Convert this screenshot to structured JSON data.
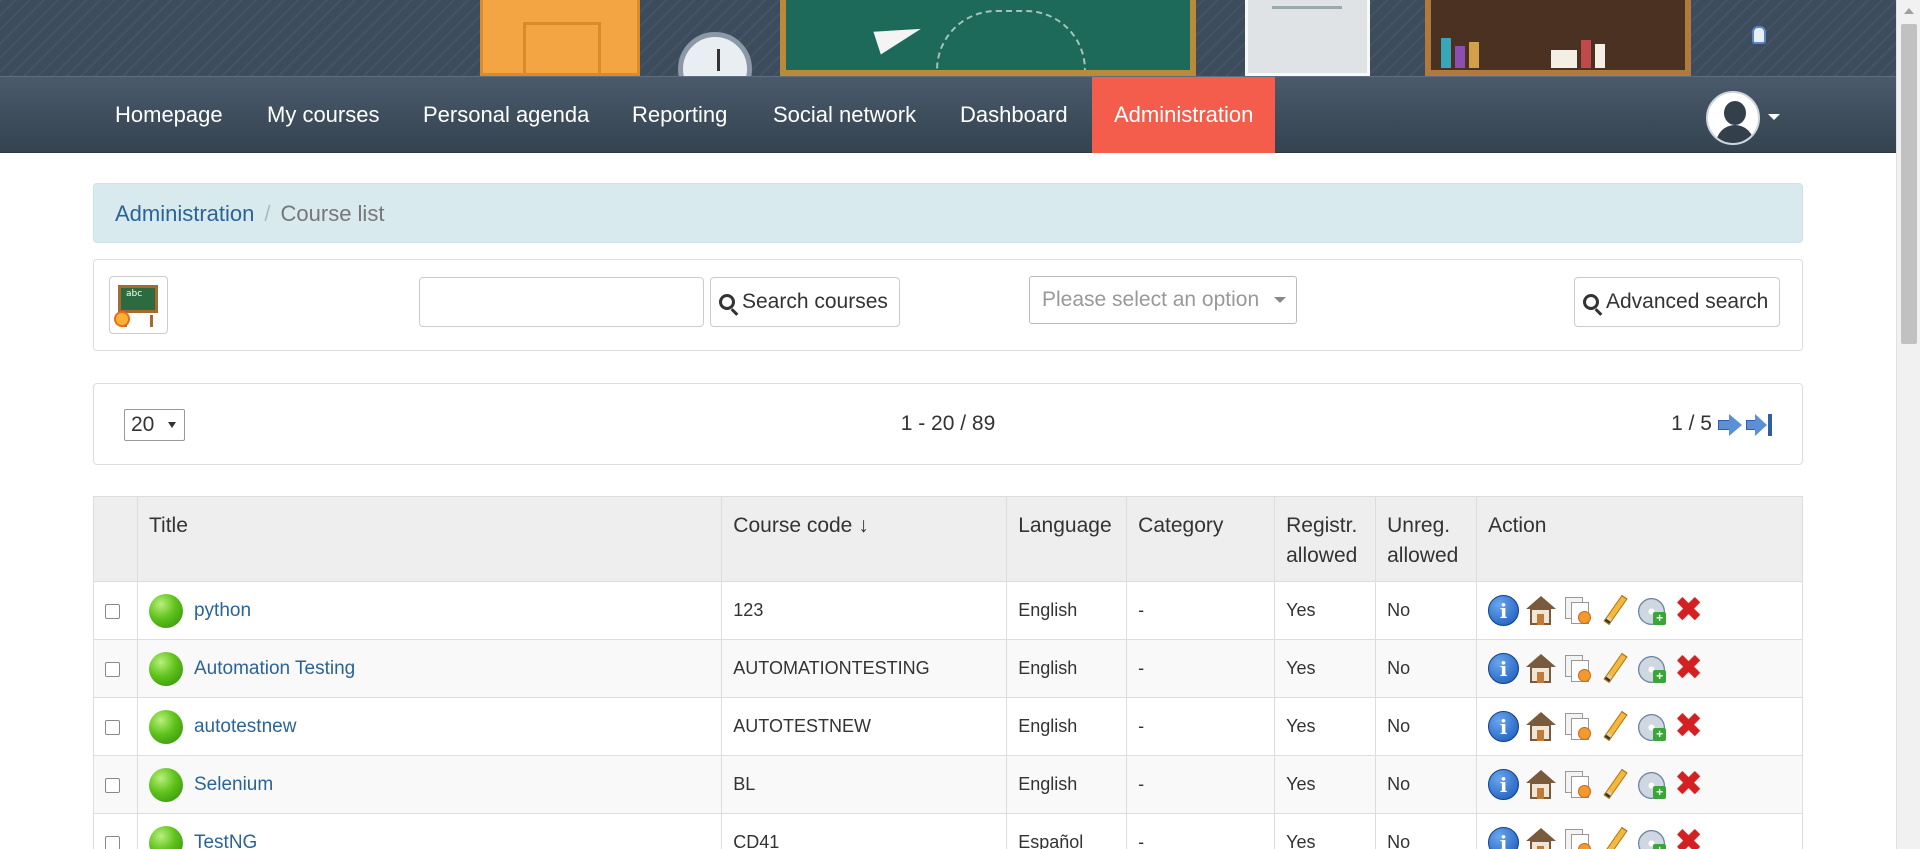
{
  "nav": {
    "items": [
      {
        "label": "Homepage",
        "active": false
      },
      {
        "label": "My courses",
        "active": false
      },
      {
        "label": "Personal agenda",
        "active": false
      },
      {
        "label": "Reporting",
        "active": false
      },
      {
        "label": "Social network",
        "active": false
      },
      {
        "label": "Dashboard",
        "active": false
      },
      {
        "label": "Administration",
        "active": true
      }
    ],
    "active_color": "#f45c4b"
  },
  "breadcrumb": {
    "root": "Administration",
    "separator": "/",
    "current": "Course list"
  },
  "toolbar": {
    "add_course_icon": "add-course-blackboard-icon",
    "add_course_icon_text": "abc",
    "search_placeholder": "",
    "search_value": "",
    "search_button_label": "Search courses",
    "category_select_placeholder": "Please select an option",
    "advanced_search_label": "Advanced search"
  },
  "pager": {
    "per_page": "20",
    "range": "1 - 20 / 89",
    "page": "1 / 5"
  },
  "table": {
    "columns": [
      "Title",
      "Course code ↓",
      "Language",
      "Category",
      "Registr. allowed",
      "Unreg. allowed",
      "Action"
    ],
    "rows": [
      {
        "title": "python",
        "code": "123",
        "language": "English",
        "category": "-",
        "registr": "Yes",
        "unreg": "No"
      },
      {
        "title": "Automation Testing",
        "code": "AUTOMATIONTESTING",
        "language": "English",
        "category": "-",
        "registr": "Yes",
        "unreg": "No"
      },
      {
        "title": "autotestnew",
        "code": "AUTOTESTNEW",
        "language": "English",
        "category": "-",
        "registr": "Yes",
        "unreg": "No"
      },
      {
        "title": "Selenium",
        "code": "BL",
        "language": "English",
        "category": "-",
        "registr": "Yes",
        "unreg": "No"
      },
      {
        "title": "TestNG",
        "code": "CD41",
        "language": "Español",
        "category": "-",
        "registr": "Yes",
        "unreg": "No"
      }
    ],
    "action_icons": [
      "info-icon",
      "home-icon",
      "copy-icon",
      "edit-pencil-icon",
      "backup-icon",
      "delete-icon"
    ],
    "info_glyph": "i",
    "delete_glyph": "✖",
    "backup_glyph": "+"
  }
}
